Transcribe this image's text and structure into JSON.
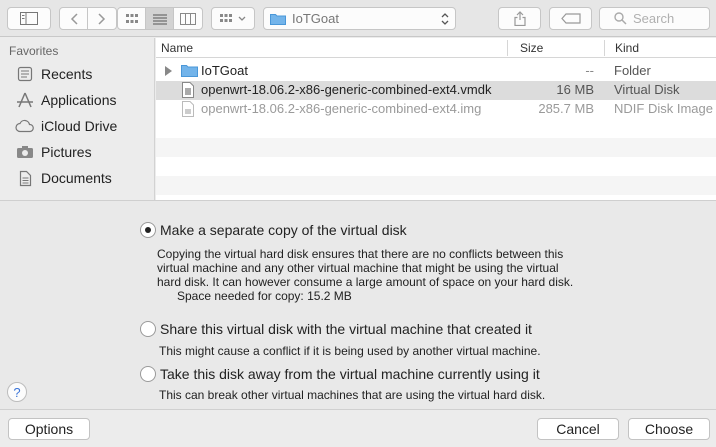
{
  "toolbar": {
    "location": "IoTGoat",
    "search_placeholder": "Search"
  },
  "sidebar": {
    "header": "Favorites",
    "items": [
      {
        "label": "Recents",
        "icon": "recents-icon"
      },
      {
        "label": "Applications",
        "icon": "applications-icon"
      },
      {
        "label": "iCloud Drive",
        "icon": "cloud-icon"
      },
      {
        "label": "Pictures",
        "icon": "camera-icon"
      },
      {
        "label": "Documents",
        "icon": "documents-icon"
      }
    ]
  },
  "filelist": {
    "columns": {
      "name": "Name",
      "size": "Size",
      "kind": "Kind"
    },
    "rows": [
      {
        "name": "IoTGoat",
        "size": "--",
        "kind": "Folder"
      },
      {
        "name": "openwrt-18.06.2-x86-generic-combined-ext4.vmdk",
        "size": "16 MB",
        "kind": "Virtual Disk"
      },
      {
        "name": "openwrt-18.06.2-x86-generic-combined-ext4.img",
        "size": "285.7 MB",
        "kind": "NDIF Disk Image"
      }
    ]
  },
  "options": {
    "copy": {
      "title": "Make a separate copy of the virtual disk",
      "desc1": "Copying the virtual hard disk ensures that there are no conflicts between this",
      "desc2": "virtual machine and any other virtual machine that might be using the virtual",
      "desc3": "hard disk.  It can however consume a large amount of space on your hard disk.",
      "space": "Space needed for copy: 15.2 MB"
    },
    "share": {
      "title": "Share this virtual disk with the virtual machine that created it",
      "desc": "This might cause a conflict if it is being used by another virtual machine."
    },
    "take": {
      "title": "Take this disk away from the virtual machine currently using it",
      "desc": "This can break other virtual machines that are using the virtual hard disk."
    },
    "help": "?"
  },
  "footer": {
    "options_label": "Options",
    "cancel_label": "Cancel",
    "choose_label": "Choose"
  },
  "colors": {
    "folder": "#5aa9e6",
    "selection": "#dcdcdc",
    "help": "#3a74d8"
  }
}
